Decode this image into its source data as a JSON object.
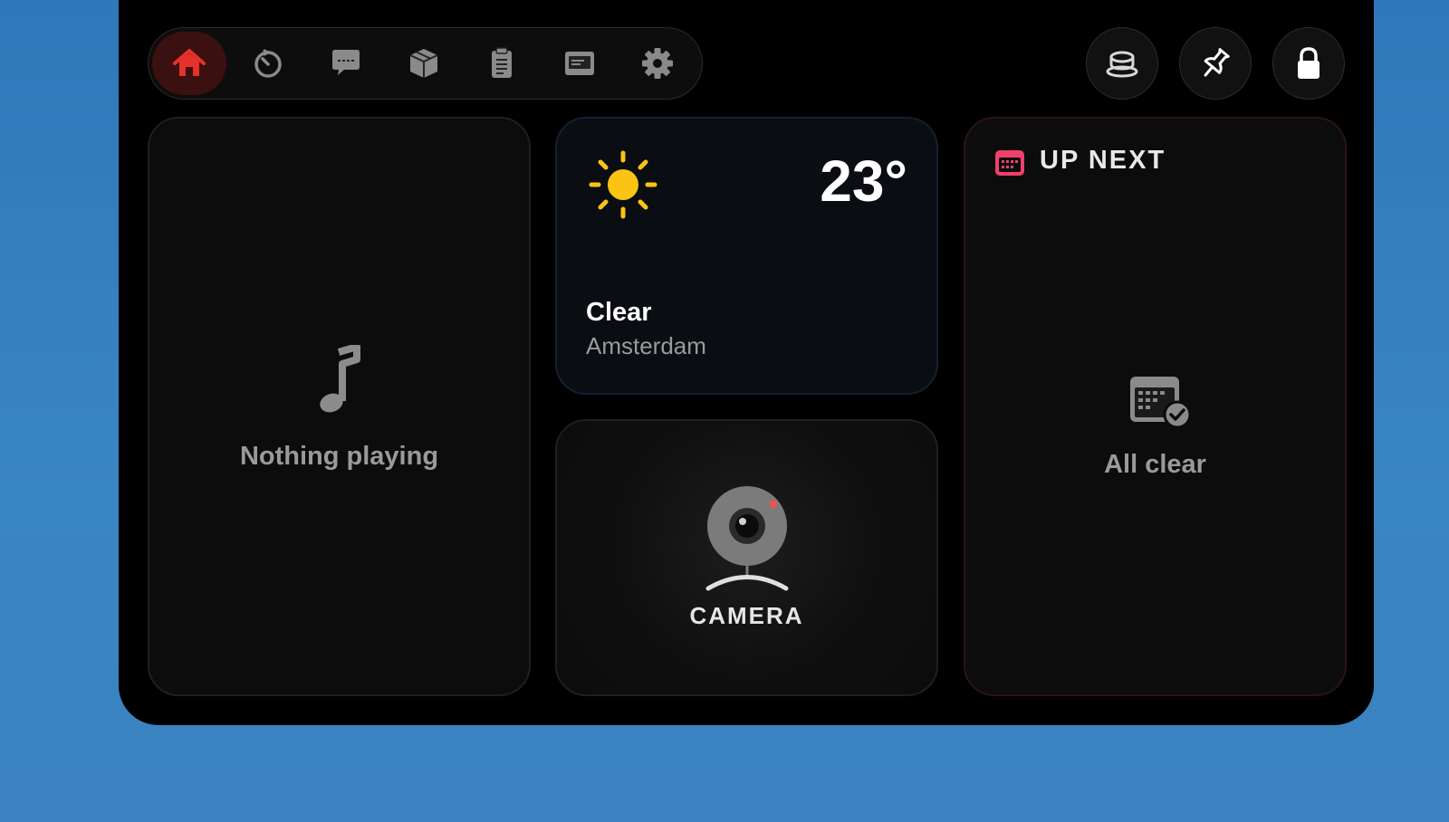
{
  "toolbar": {
    "tabs": [
      {
        "icon": "home-icon",
        "active": true
      },
      {
        "icon": "timer-icon",
        "active": false
      },
      {
        "icon": "chat-icon",
        "active": false
      },
      {
        "icon": "box-icon",
        "active": false
      },
      {
        "icon": "clipboard-icon",
        "active": false
      },
      {
        "icon": "display-icon",
        "active": false
      },
      {
        "icon": "gear-icon",
        "active": false
      }
    ],
    "accent": "#e5322d"
  },
  "actions": [
    {
      "icon": "coffee-cup-icon"
    },
    {
      "icon": "pin-icon"
    },
    {
      "icon": "lock-icon"
    }
  ],
  "music": {
    "status": "Nothing playing",
    "icon": "music-note-icon"
  },
  "weather": {
    "temperature": "23°",
    "condition": "Clear",
    "location": "Amsterdam",
    "icon": "sun-icon",
    "sun_color": "#f9c414"
  },
  "camera": {
    "label": "CAMERA",
    "icon": "webcam-icon"
  },
  "calendar": {
    "title": "UP NEXT",
    "status": "All clear",
    "accent": "#f0406a"
  }
}
